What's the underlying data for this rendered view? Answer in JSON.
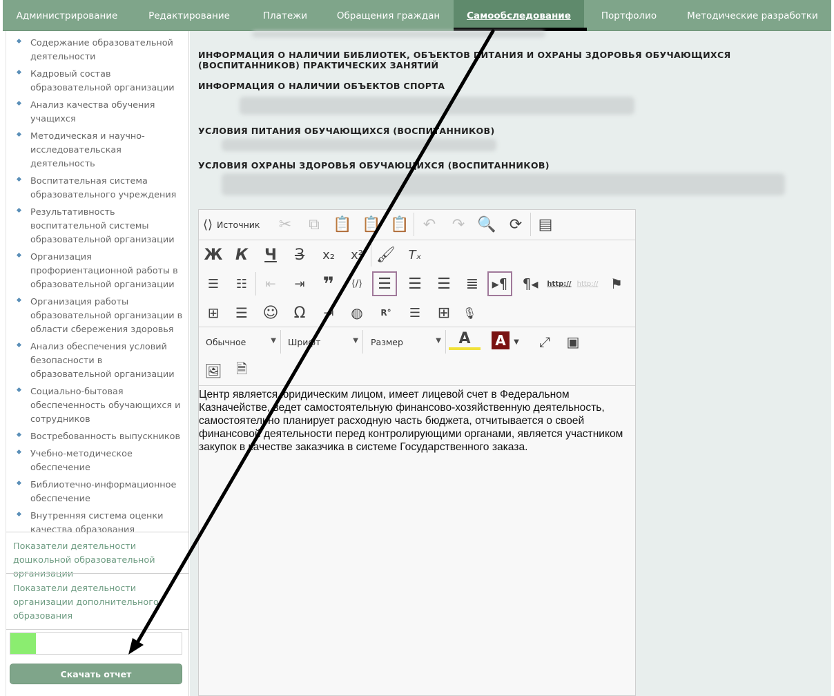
{
  "nav": {
    "tabs": [
      {
        "label": "Администрирование",
        "active": false
      },
      {
        "label": "Редактирование",
        "active": false
      },
      {
        "label": "Платежи",
        "active": false
      },
      {
        "label": "Обращения граждан",
        "active": false
      },
      {
        "label": "Самообследование",
        "active": true
      },
      {
        "label": "Портфолио",
        "active": false
      },
      {
        "label": "Методические разработки",
        "active": false
      }
    ]
  },
  "sidebar": {
    "items": [
      {
        "label": "Содержание образовательной деятельности"
      },
      {
        "label": "Кадровый состав образовательной организации"
      },
      {
        "label": "Анализ качества обучения учащихся"
      },
      {
        "label": "Методическая и научно-исследовательская деятельность"
      },
      {
        "label": "Воспитательная система образовательного учреждения"
      },
      {
        "label": "Результативность воспитательной системы образовательной организации"
      },
      {
        "label": "Организация профориентационной работы в образовательной организации"
      },
      {
        "label": "Организация работы образовательной организации в области сбережения здоровья"
      },
      {
        "label": "Анализ обеспечения условий безопасности в образовательной организации"
      },
      {
        "label": "Социально-бытовая обеспеченность обучающихся и сотрудников"
      },
      {
        "label": "Востребованность выпускников"
      },
      {
        "label": "Учебно-методическое обеспечение"
      },
      {
        "label": "Библиотечно-информационное обеспечение"
      },
      {
        "label": "Внутренняя система оценки качества образования"
      }
    ],
    "link_preschool": "Показатели деятельности дошкольной образовательной организации",
    "link_additional": "Показатели деятельности организации дополнительного образования",
    "progress": 0.15,
    "download_label": "Скачать отчет"
  },
  "main": {
    "headings": [
      "ИНФОРМАЦИЯ О НАЛИЧИИ БИБЛИОТЕК, ОБЪЕКТОВ ПИТАНИЯ И ОХРАНЫ ЗДОРОВЬЯ ОБУЧАЮЩИХСЯ (ВОСПИТАННИКОВ) ПРАКТИЧЕСКИХ ЗАНЯТИЙ",
      "ИНФОРМАЦИЯ О НАЛИЧИИ ОБЪЕКТОВ СПОРТА",
      "УСЛОВИЯ ПИТАНИЯ ОБУЧАЮЩИХСЯ (ВОСПИТАННИКОВ)",
      "УСЛОВИЯ ОХРАНЫ ЗДОРОВЬЯ ОБУЧАЮЩИХСЯ (ВОСПИТАННИКОВ)"
    ]
  },
  "editor": {
    "source_label": "Источник",
    "format_combo": "Обычное",
    "font_combo": "Шрифт",
    "size_combo": "Размер",
    "bold_glyph": "Ж",
    "italic_glyph": "К",
    "underline_glyph": "Ч",
    "strike_glyph": "З",
    "link_glyph": "http://",
    "content": "Центр является юридическим лицом, имеет лицевой счет в Федеральном Казначействе, ведет самостоятельную финансово-хозяйственную деятельность, самостоятельно планирует расходную часть бюджета, отчитывается о своей финансовой деятельности перед контролирующими органами, является участником закупок в качестве заказчика в системе Государственного заказа."
  },
  "colors": {
    "nav_bg": "#7fa58a",
    "nav_active": "#5f8a6c",
    "link": "#6e9c82",
    "progress_fill": "#8bed70",
    "content_bg": "#e8eeed"
  }
}
